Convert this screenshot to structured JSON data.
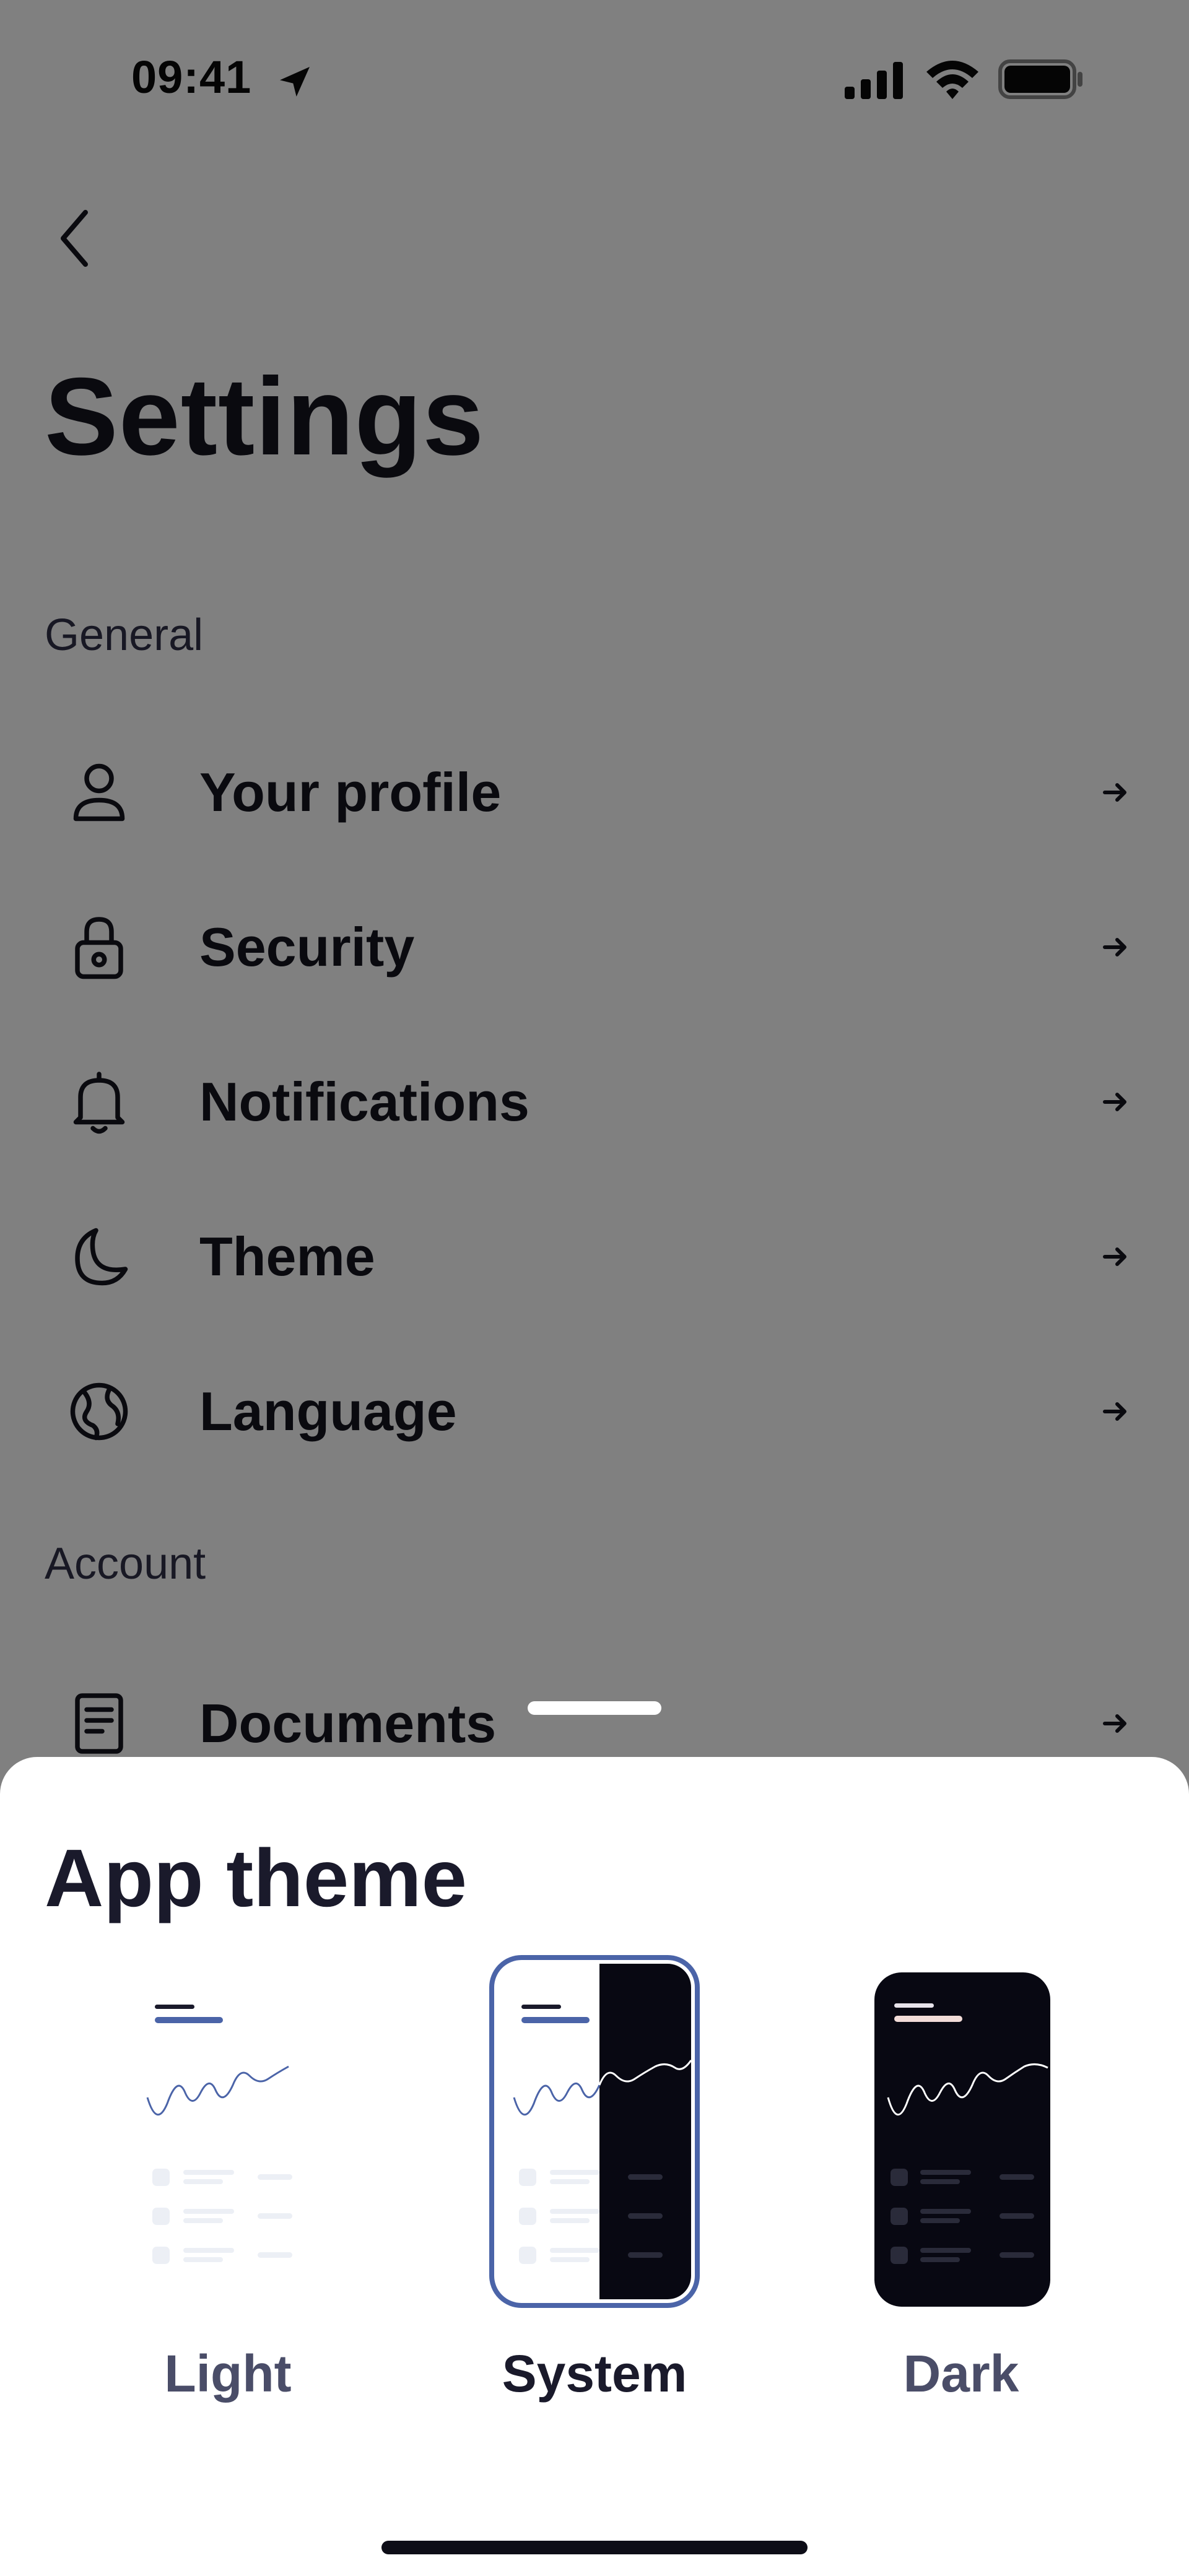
{
  "status_bar": {
    "time": "09:41"
  },
  "header": {
    "title": "Settings"
  },
  "sections": [
    {
      "label": "General",
      "items": [
        {
          "label": "Your profile",
          "icon": "user-icon"
        },
        {
          "label": "Security",
          "icon": "lock-icon"
        },
        {
          "label": "Notifications",
          "icon": "bell-icon"
        },
        {
          "label": "Theme",
          "icon": "moon-icon"
        },
        {
          "label": "Language",
          "icon": "globe-icon"
        }
      ]
    },
    {
      "label": "Account",
      "items": [
        {
          "label": "Documents",
          "icon": "document-icon"
        }
      ]
    }
  ],
  "sheet": {
    "title": "App theme",
    "options": [
      {
        "label": "Light",
        "selected": false
      },
      {
        "label": "System",
        "selected": true
      },
      {
        "label": "Dark",
        "selected": false
      }
    ]
  },
  "colors": {
    "accent": "#4b64a8",
    "text": "#14141f",
    "scrim": "#808080",
    "dark_preview": "#080812"
  }
}
